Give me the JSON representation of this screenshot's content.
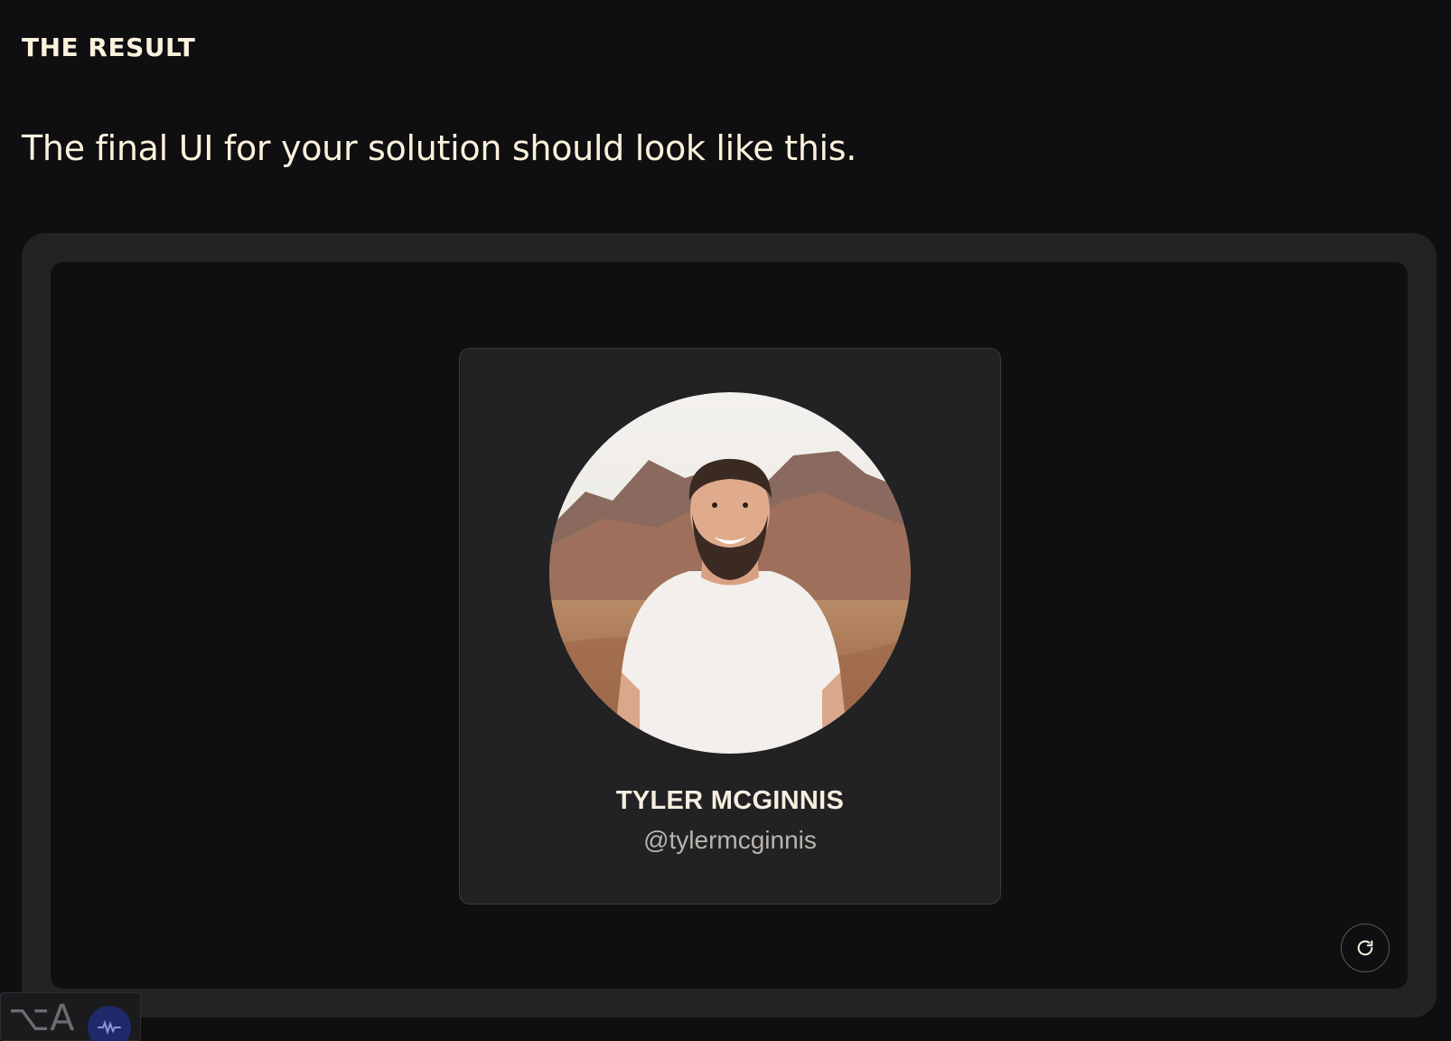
{
  "section": {
    "heading": "THE RESULT",
    "lead": "The final UI for your solution should look like this."
  },
  "profile": {
    "name": "TYLER MCGINNIS",
    "handle": "@tylermcginnis",
    "avatar_icon": "profile-photo"
  },
  "controls": {
    "refresh_icon": "refresh-icon"
  },
  "dock": {
    "glyph": "⌥A",
    "badge_icon": "waveform-icon",
    "badge_color": "#1f2a6b"
  }
}
